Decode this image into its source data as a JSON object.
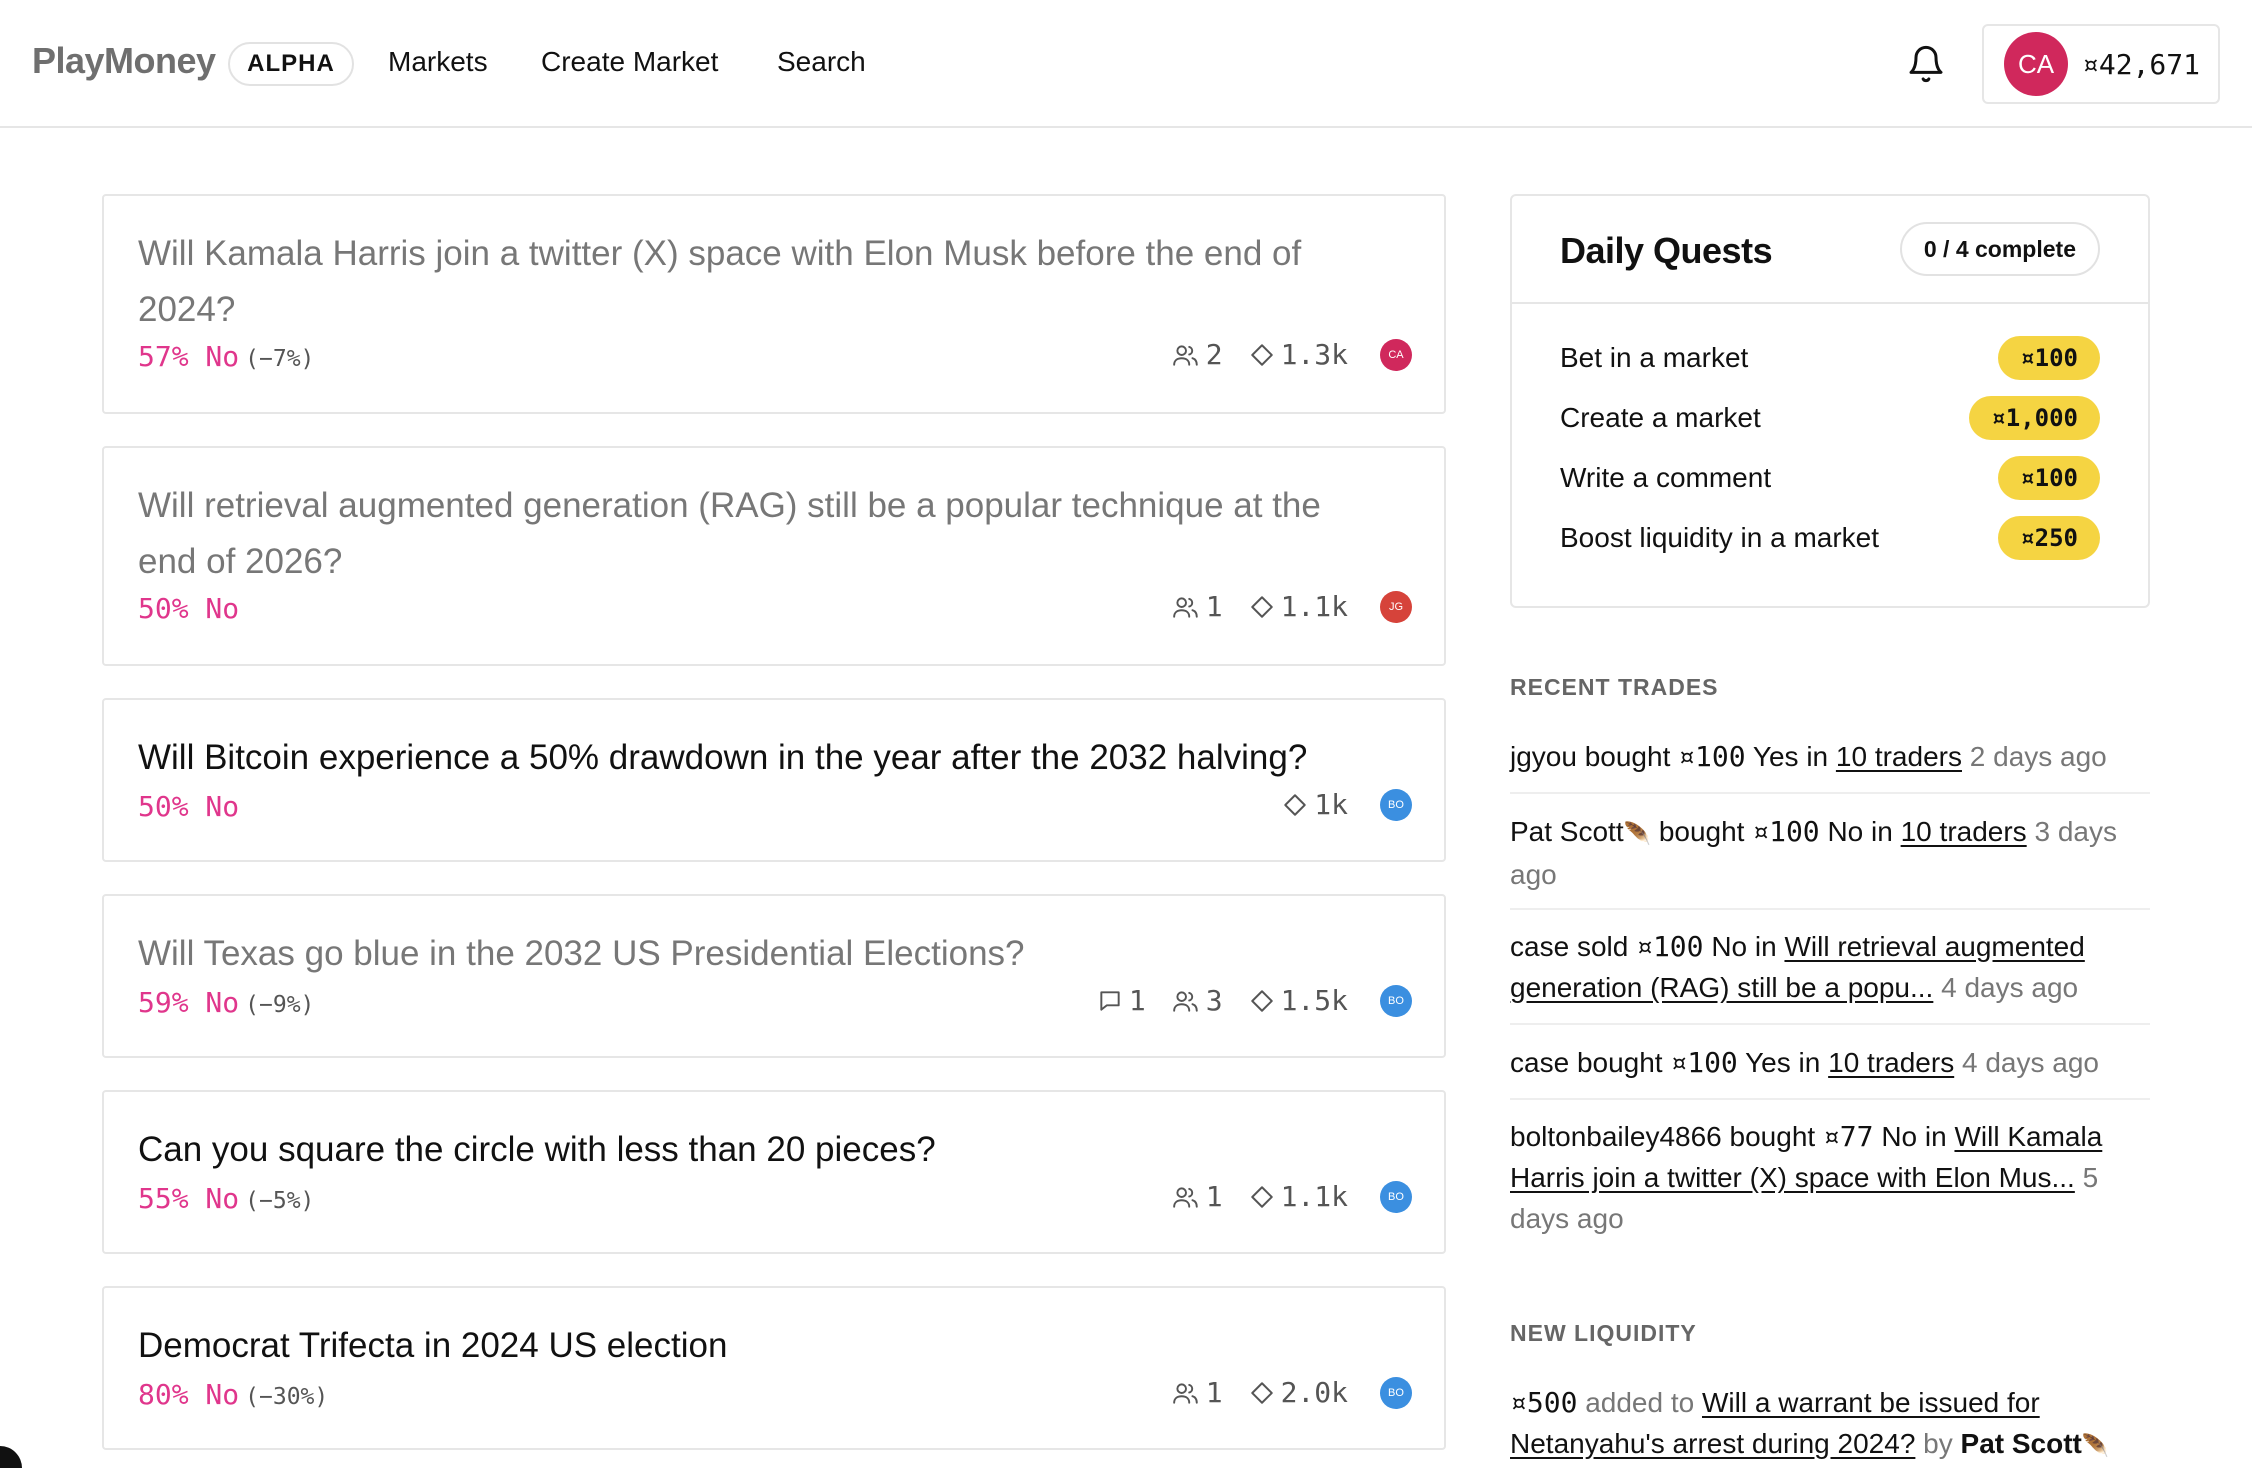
{
  "header": {
    "logo": "PlayMoney",
    "alpha_badge": "ALPHA",
    "nav": [
      "Markets",
      "Create Market",
      "Search"
    ],
    "user_initials": "CA",
    "balance": "¤42,671",
    "colors": {
      "avatar": "#d0285c"
    }
  },
  "markets": [
    {
      "title_line1": "Will Kamala Harris join a twitter (X) space with Elon Musk before the end of",
      "title_line2": "2024?",
      "prob": "57% No",
      "change": "(−7%)",
      "comments": "",
      "traders": "2",
      "liquidity": "1.3k",
      "avatar": "CA",
      "avatar_color": "#d0285c"
    },
    {
      "title_line1": "Will retrieval augmented generation (RAG) still be a popular technique at the",
      "title_line2": "end of 2026?",
      "prob": "50% No",
      "change": "",
      "comments": "",
      "traders": "1",
      "liquidity": "1.1k",
      "avatar": "JG",
      "avatar_color": "#d6433a"
    },
    {
      "title_line1": "Will Bitcoin experience a 50% drawdown in the year after the 2032 halving?",
      "title_line2": "",
      "prob": "50% No",
      "change": "",
      "comments": "",
      "traders": "",
      "liquidity": "1k",
      "avatar": "BO",
      "avatar_color": "#3b8fe0"
    },
    {
      "title_line1": "Will Texas go blue in the 2032 US Presidential Elections?",
      "title_line2": "",
      "prob": "59% No",
      "change": "(−9%)",
      "comments": "1",
      "traders": "3",
      "liquidity": "1.5k",
      "avatar": "BO",
      "avatar_color": "#3b8fe0"
    },
    {
      "title_line1": "Can you square the circle with less than 20 pieces?",
      "title_line2": "",
      "prob": "55% No",
      "change": "(−5%)",
      "comments": "",
      "traders": "1",
      "liquidity": "1.1k",
      "avatar": "BO",
      "avatar_color": "#3b8fe0"
    },
    {
      "title_line1": "Democrat Trifecta in 2024 US election",
      "title_line2": "",
      "prob": "80% No",
      "change": "(−30%)",
      "comments": "",
      "traders": "1",
      "liquidity": "2.0k",
      "avatar": "BO",
      "avatar_color": "#3b8fe0"
    }
  ],
  "quests": {
    "title": "Daily Quests",
    "progress": "0 / 4 complete",
    "items": [
      {
        "label": "Bet in a market",
        "reward": "¤100"
      },
      {
        "label": "Create a market",
        "reward": "¤1,000"
      },
      {
        "label": "Write a comment",
        "reward": "¤100"
      },
      {
        "label": "Boost liquidity in a market",
        "reward": "¤250"
      }
    ],
    "colors": {
      "reward_bg": "#f5d442"
    }
  },
  "recent_trades": {
    "heading": "RECENT TRADES",
    "items": [
      {
        "user": "jgyou",
        "action": "bought",
        "amount": "¤100",
        "side": "Yes",
        "in": "in",
        "market_line1": "10 traders",
        "market_line2": "",
        "time": "2 days ago"
      },
      {
        "user": "Pat Scott",
        "action": "bought",
        "amount": "¤100",
        "side": "No",
        "in": "in",
        "market_line1": "10 traders",
        "market_line2": "",
        "time": "3 days ago"
      },
      {
        "user": "case",
        "action": "sold",
        "amount": "¤100",
        "side": "No",
        "in": "in",
        "market_line1": "Will retrieval augmented",
        "market_line2": "generation (RAG) still be a popu...",
        "time": "4 days ago"
      },
      {
        "user": "case",
        "action": "bought",
        "amount": "¤100",
        "side": "Yes",
        "in": "in",
        "market_line1": "10 traders",
        "market_line2": "",
        "time": "4 days ago"
      },
      {
        "user": "boltonbailey4866",
        "action": "bought",
        "amount": "¤77",
        "side": "No",
        "in": "in",
        "market_line1": "Will Kamala",
        "market_line2": "Harris join a twitter (X) space with Elon Mus...",
        "time": "5 days ago"
      }
    ]
  },
  "new_liquidity": {
    "heading": "NEW LIQUIDITY",
    "amount": "¤500",
    "added_to": "added to",
    "market_line1": "Will a warrant be issued for",
    "market_line2": "Netanyahu's arrest during 2024?",
    "by": "by",
    "user": "Pat Scott"
  }
}
